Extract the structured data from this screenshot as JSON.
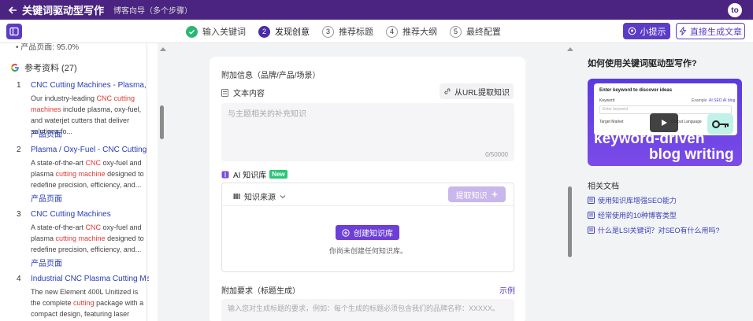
{
  "topbar": {
    "title": "关键词驱动型写作",
    "subtitle": "博客向导（多个步骤）",
    "avatar": "to"
  },
  "steps": [
    {
      "num": "",
      "label": "输入关键词",
      "state": "done"
    },
    {
      "num": "2",
      "label": "发现创意",
      "state": "active"
    },
    {
      "num": "3",
      "label": "推荐标题",
      "state": "todo"
    },
    {
      "num": "4",
      "label": "推荐大纲",
      "state": "todo"
    },
    {
      "num": "5",
      "label": "最终配置",
      "state": "todo"
    }
  ],
  "header_buttons": {
    "tips": "小提示",
    "direct": "直接生成文章"
  },
  "left": {
    "partial_text": "• 产品页面: 95.0%",
    "references_header": "参考资料 (27)",
    "references": [
      {
        "num": "1",
        "title": "CNC Cutting Machines - Plasma, Oxy...",
        "desc_parts": [
          {
            "t": "Our industry-leading ",
            "hl": false
          },
          {
            "t": "CNC cutting machines",
            "hl": true
          },
          {
            "t": " include plasma, oxy-fuel, and waterjet cutters that deliver solutions fo...",
            "hl": false
          }
        ],
        "tag": "产品页面"
      },
      {
        "num": "2",
        "title": "Plasma / Oxy-Fuel - CNC Cutting Ma...",
        "desc_parts": [
          {
            "t": "A state-of-the-art ",
            "hl": false
          },
          {
            "t": "CNC",
            "hl": true
          },
          {
            "t": " oxy-fuel and plasma ",
            "hl": false
          },
          {
            "t": "cutting machine",
            "hl": true
          },
          {
            "t": " designed to redefine precision, efficiency, and...",
            "hl": false
          }
        ],
        "tag": "产品页面"
      },
      {
        "num": "3",
        "title": "CNC Cutting Machines",
        "desc_parts": [
          {
            "t": "A state-of-the-art ",
            "hl": false
          },
          {
            "t": "CNC",
            "hl": true
          },
          {
            "t": " oxy-fuel and plasma ",
            "hl": false
          },
          {
            "t": "cutting machine",
            "hl": true
          },
          {
            "t": " designed to redefine precision, efficiency, and...",
            "hl": false
          }
        ],
        "tag": "产品页面"
      },
      {
        "num": "4",
        "title": "Industrial CNC Plasma Cutting Machi...",
        "desc_parts": [
          {
            "t": "The new Element 400L Unitized is the complete ",
            "hl": false
          },
          {
            "t": "cutting",
            "hl": true
          },
          {
            "t": " package with a compact design, featuring laser bevelin...",
            "hl": false
          }
        ],
        "tag": ""
      }
    ]
  },
  "center": {
    "extra_info_label": "附加信息（品牌/产品/场景）",
    "text_content_label": "文本内容",
    "url_button": "从URL提取知识",
    "textarea_placeholder": "与主题相关的补充知识",
    "char_count": "0/50000",
    "ai_kb_label": "AI 知识库",
    "new_badge": "New",
    "kb_source_label": "知识来源",
    "extract_button": "提取知识",
    "create_button": "创建知识库",
    "empty_text": "你尚未创建任何知识库。",
    "extra_req_label": "附加要求（标题生成）",
    "example_link": "示例",
    "req_placeholder": "输入您对生成标题的要求，例如：每个生成的标题必须包含我们的品牌名称：XXXXX。"
  },
  "right": {
    "heading": "如何使用关键词驱动型写作?",
    "video": {
      "card_title": "Enter keyword to discover ideas",
      "keyword_label": "Keyword",
      "example_label": "Example",
      "example_values": "AI SEO  AI blog",
      "input_placeholder": "Enter keyword",
      "target_market": "Target Market",
      "output_language": "Output Language",
      "line1": "keyword-driven",
      "line2": "blog writing"
    },
    "docs_label": "相关文档",
    "docs": [
      "使用知识库增强SEO能力",
      "经常使用的10种博客类型",
      "什么是LSI关键词？对SEO有什么用吗?"
    ]
  },
  "colors": {
    "topbar": "#4a2480",
    "accent": "#5b3cc4",
    "link": "#2a3bb5",
    "highlight": "#e53935",
    "success": "#2bb673"
  }
}
